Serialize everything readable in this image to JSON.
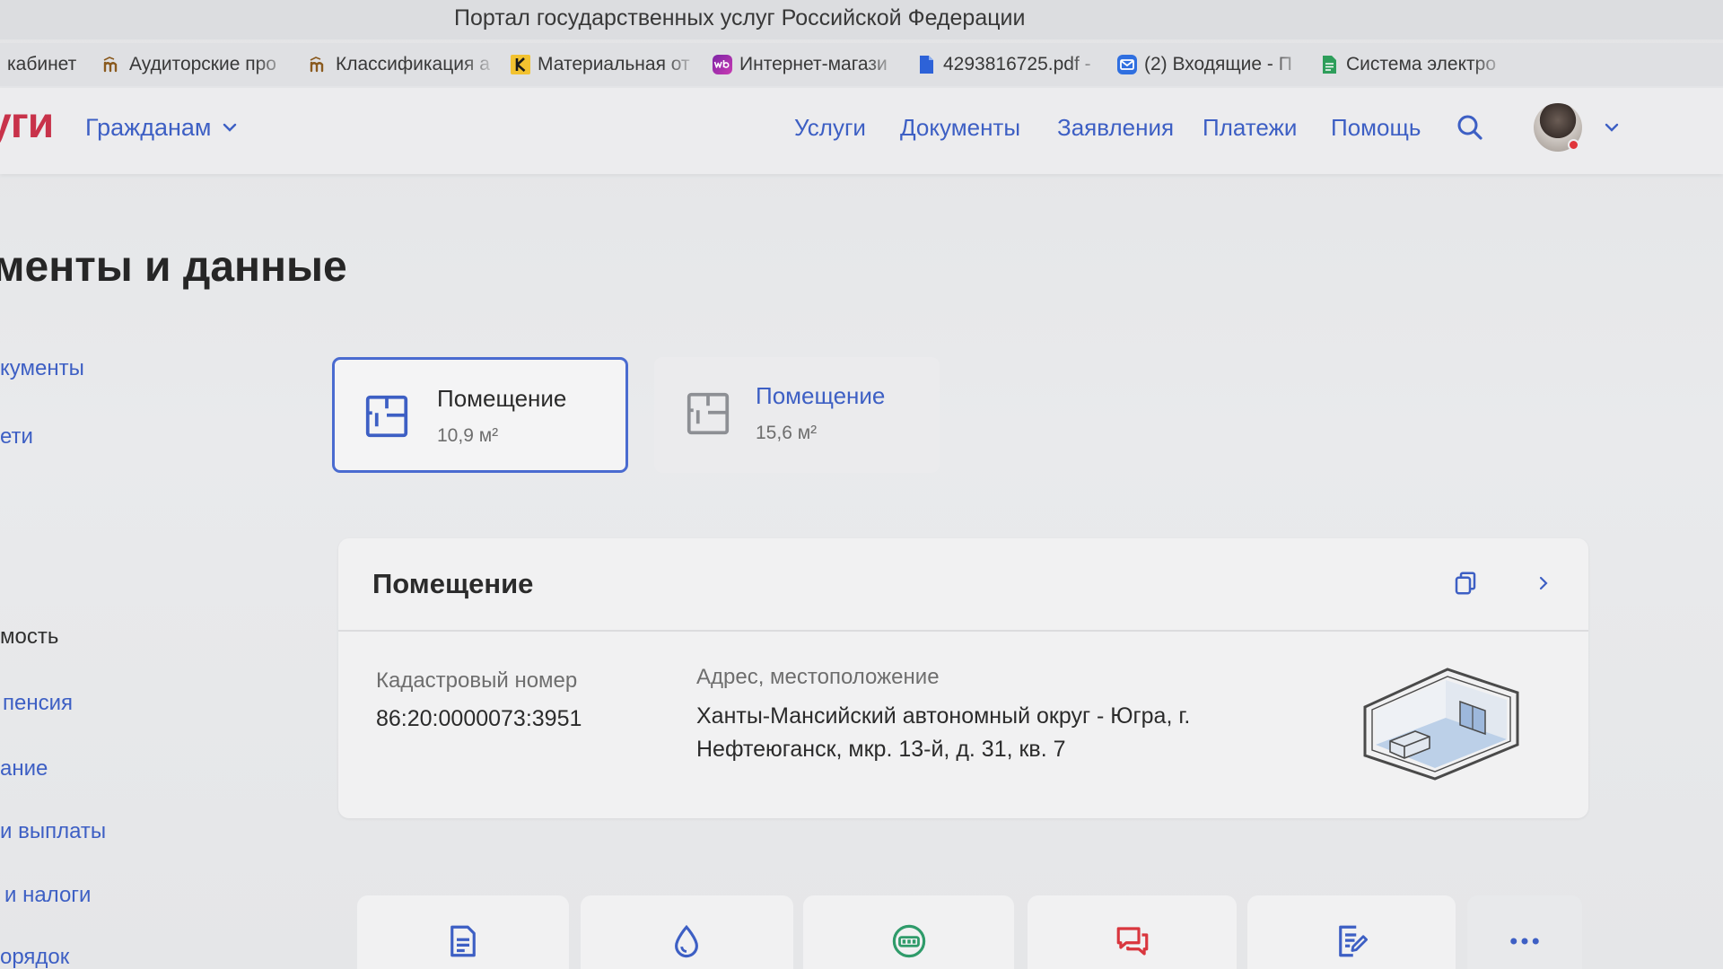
{
  "window": {
    "title": "Портал государственных услуг Российской Федерации"
  },
  "bookmarks": [
    {
      "label": "кабинет"
    },
    {
      "label": "Аудиторские про",
      "icon": "m-logo-icon"
    },
    {
      "label": "Классификация а",
      "icon": "m-logo-icon"
    },
    {
      "label": "Материальная от",
      "icon": "k-logo-icon"
    },
    {
      "label": "Интернет-магази",
      "icon": "wb-logo-icon"
    },
    {
      "label": "4293816725.pdf -",
      "icon": "pdf-file-icon"
    },
    {
      "label": "(2) Входящие - П",
      "icon": "mail-icon"
    },
    {
      "label": "Система электро",
      "icon": "green-doc-icon"
    }
  ],
  "header": {
    "logo": "уги",
    "audience_menu": "Гражданам",
    "nav": [
      {
        "label": "Услуги"
      },
      {
        "label": "Документы"
      },
      {
        "label": "Заявления"
      },
      {
        "label": "Платежи"
      },
      {
        "label": "Помощь"
      }
    ],
    "search_icon": "search-icon",
    "profile_icon": "avatar"
  },
  "page": {
    "title": "менты и данные"
  },
  "sidebar": {
    "items": [
      {
        "label": "кументы"
      },
      {
        "label": "ети"
      },
      {
        "label": "мость",
        "active": true
      },
      {
        "label": "пенсия"
      },
      {
        "label": "ание"
      },
      {
        "label": "и выплаты"
      },
      {
        "label": "и налоги"
      },
      {
        "label": "орядок"
      }
    ]
  },
  "properties": [
    {
      "title": "Помещение",
      "area": "10,9 м²",
      "selected": true,
      "icon": "floor-plan-icon"
    },
    {
      "title": "Помещение",
      "area": "15,6 м²",
      "selected": false,
      "icon": "floor-plan-icon"
    }
  ],
  "detail": {
    "title": "Помещение",
    "cadastral_label": "Кадастровый номер",
    "cadastral_value": "86:20:0000073:3951",
    "address_label": "Адрес, местоположение",
    "address_value": "Ханты-Мансийский автономный округ - Югра, г. Нефтеюганск, мкр. 13-й, д. 31, кв. 7",
    "icons": [
      "copy-icon",
      "chevron-right-icon",
      "room-illustration"
    ]
  },
  "quick_actions": [
    {
      "icon": "document-icon"
    },
    {
      "icon": "water-drop-icon"
    },
    {
      "icon": "gas-meter-icon"
    },
    {
      "icon": "chat-icon"
    },
    {
      "icon": "form-edit-icon"
    },
    {
      "icon": "more-icon"
    }
  ],
  "colors": {
    "accent": "#3d5fc4",
    "logo": "#c8324a",
    "text": "#2b2b2b",
    "muted": "#6e6e6e",
    "selected_border": "#4a6bd0",
    "chat_icon": "#d9363e",
    "meter_icon": "#2f9b6a"
  }
}
